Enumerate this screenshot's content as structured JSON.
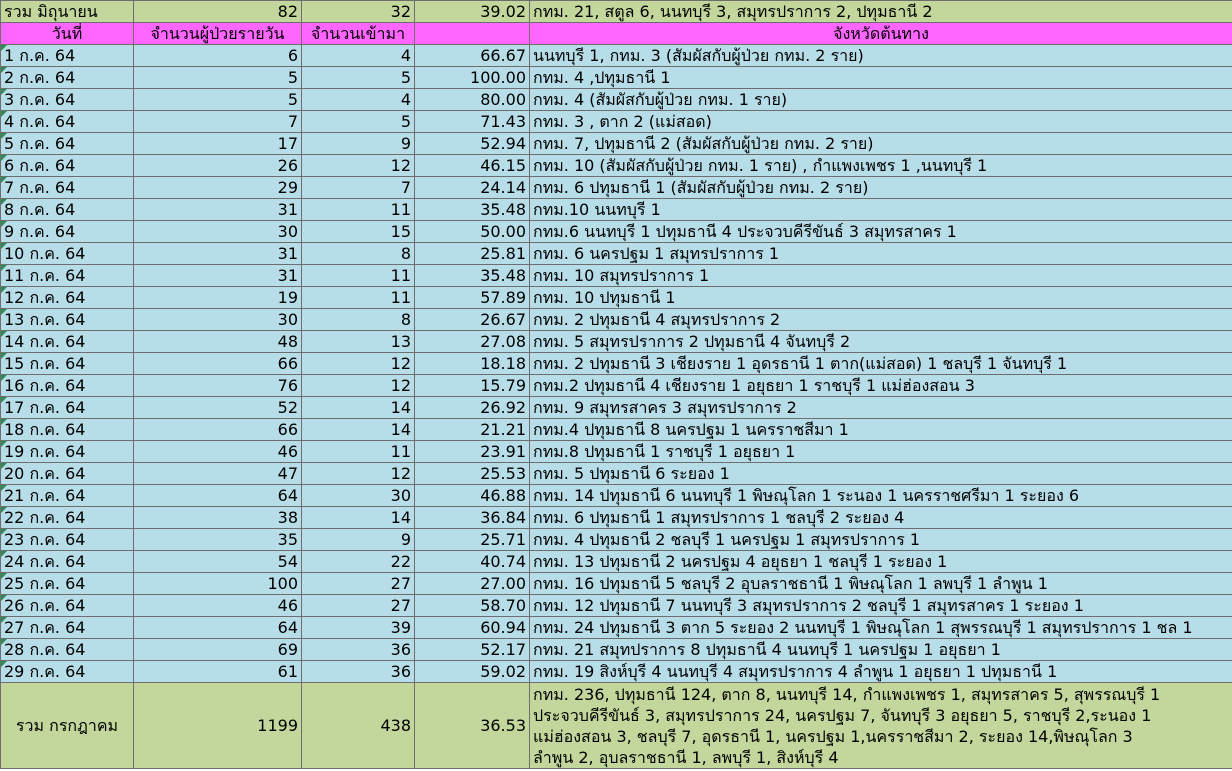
{
  "june_total": {
    "label": "รวม มิถุนายน",
    "daily": "82",
    "inbound": "32",
    "percent": "39.02",
    "provinces": "กทม. 21, สตูล 6, นนทบุรี 3, สมุทรปราการ 2, ปทุมธานี 2"
  },
  "headers": {
    "date": "วันที่",
    "daily": "จำนวนผู้ป่วยรายวัน",
    "inbound": "จำนวนเข้ามา",
    "percent": "",
    "provinces": "จังหวัดต้นทาง"
  },
  "rows": [
    {
      "date": "1 ก.ค. 64",
      "daily": "6",
      "inbound": "4",
      "percent": "66.67",
      "provinces": "นนทบุรี 1, กทม. 3          (สัมผัสกับผู้ป่วย กทม. 2 ราย)"
    },
    {
      "date": "2 ก.ค. 64",
      "daily": "5",
      "inbound": "5",
      "percent": "100.00",
      "provinces": "กทม. 4 ,ปทุมธานี 1"
    },
    {
      "date": "3 ก.ค. 64",
      "daily": "5",
      "inbound": "4",
      "percent": "80.00",
      "provinces": "กทม. 4                              (สัมผัสกับผู้ป่วย กทม. 1 ราย)"
    },
    {
      "date": "4 ก.ค. 64",
      "daily": "7",
      "inbound": "5",
      "percent": "71.43",
      "provinces": "กทม. 3 , ตาก 2 (แม่สอด)"
    },
    {
      "date": "5 ก.ค. 64",
      "daily": "17",
      "inbound": "9",
      "percent": "52.94",
      "provinces": "กทม. 7, ปทุมธานี 2      (สัมผัสกับผู้ป่วย กทม. 2 ราย)"
    },
    {
      "date": "6 ก.ค. 64",
      "daily": "26",
      "inbound": "12",
      "percent": "46.15",
      "provinces": "กทม. 10 (สัมผัสกับผู้ป่วย กทม. 1 ราย) , กำแพงเพชร 1 ,นนทบุรี 1"
    },
    {
      "date": "7 ก.ค. 64",
      "daily": "29",
      "inbound": "7",
      "percent": "24.14",
      "provinces": "กทม. 6 ปทุมธานี 1 (สัมผัสกับผู้ป่วย กทม. 2 ราย)"
    },
    {
      "date": "8 ก.ค. 64",
      "daily": "31",
      "inbound": "11",
      "percent": "35.48",
      "provinces": "กทม.10 นนทบุรี 1"
    },
    {
      "date": "9 ก.ค. 64",
      "daily": "30",
      "inbound": "15",
      "percent": "50.00",
      "provinces": "กทม.6 นนทบุรี 1 ปทุมธานี 4 ประจวบคีรีขันธ์ 3 สมุทรสาคร 1"
    },
    {
      "date": "10 ก.ค. 64",
      "daily": "31",
      "inbound": "8",
      "percent": "25.81",
      "provinces": "กทม. 6 นครปฐม 1 สมุทรปราการ 1"
    },
    {
      "date": "11 ก.ค. 64",
      "daily": "31",
      "inbound": "11",
      "percent": "35.48",
      "provinces": "กทม. 10 สมุทรปราการ 1"
    },
    {
      "date": "12 ก.ค. 64",
      "daily": "19",
      "inbound": "11",
      "percent": "57.89",
      "provinces": "กทม. 10 ปทุมธานี 1"
    },
    {
      "date": "13 ก.ค. 64",
      "daily": "30",
      "inbound": "8",
      "percent": "26.67",
      "provinces": "กทม. 2 ปทุมธานี 4 สมุทรปราการ 2"
    },
    {
      "date": "14 ก.ค. 64",
      "daily": "48",
      "inbound": "13",
      "percent": "27.08",
      "provinces": "กทม. 5 สมุทรปราการ 2 ปทุมธานี 4 จันทบุรี 2"
    },
    {
      "date": "15 ก.ค. 64",
      "daily": "66",
      "inbound": "12",
      "percent": "18.18",
      "provinces": "กทม. 2 ปทุมธานี 3 เชียงราย 1 อุดรธานี 1 ตาก(แม่สอด) 1 ชลบุรี 1 จันทบุรี 1"
    },
    {
      "date": "16 ก.ค. 64",
      "daily": "76",
      "inbound": "12",
      "percent": "15.79",
      "provinces": "กทม.2 ปทุมธานี 4 เชียงราย 1 อยุธยา 1 ราชบุรี 1 แม่ฮ่องสอน 3"
    },
    {
      "date": "17 ก.ค. 64",
      "daily": "52",
      "inbound": "14",
      "percent": "26.92",
      "provinces": "กทม. 9 สมุทรสาคร 3 สมุทรปราการ 2"
    },
    {
      "date": "18 ก.ค. 64",
      "daily": "66",
      "inbound": "14",
      "percent": "21.21",
      "provinces": "กทม.4 ปทุมธานี 8 นครปฐม 1 นครราชสีมา 1"
    },
    {
      "date": "19 ก.ค. 64",
      "daily": "46",
      "inbound": "11",
      "percent": "23.91",
      "provinces": "กทม.8 ปทุมธานี 1 ราชบุรี 1 อยุธยา 1"
    },
    {
      "date": "20 ก.ค. 64",
      "daily": "47",
      "inbound": "12",
      "percent": "25.53",
      "provinces": "กทม. 5 ปทุมธานี 6 ระยอง 1"
    },
    {
      "date": "21 ก.ค. 64",
      "daily": "64",
      "inbound": "30",
      "percent": "46.88",
      "provinces": "กทม. 14 ปทุมธานี 6 นนทบุรี 1 พิษณุโลก 1 ระนอง 1 นครราชศรีมา 1 ระยอง 6"
    },
    {
      "date": "22 ก.ค. 64",
      "daily": "38",
      "inbound": "14",
      "percent": "36.84",
      "provinces": "กทม. 6 ปทุมธานี 1 สมุทรปราการ 1 ชลบุรี 2 ระยอง 4"
    },
    {
      "date": "23 ก.ค. 64",
      "daily": "35",
      "inbound": "9",
      "percent": "25.71",
      "provinces": "กทม. 4 ปทุมธานี 2 ชลบุรี 1 นครปฐม 1 สมุทรปราการ 1"
    },
    {
      "date": "24 ก.ค. 64",
      "daily": "54",
      "inbound": "22",
      "percent": "40.74",
      "provinces": "กทม. 13 ปทุมธานี 2 นครปฐม 4 อยุธยา 1 ชลบุรี 1 ระยอง 1"
    },
    {
      "date": "25 ก.ค. 64",
      "daily": "100",
      "inbound": "27",
      "percent": "27.00",
      "provinces": "กทม. 16 ปทุมธานี 5 ชลบุรี 2 อุบลราชธานี 1 พิษณุโลก 1 ลพบุรี 1 ลำพูน 1"
    },
    {
      "date": "26 ก.ค. 64",
      "daily": "46",
      "inbound": "27",
      "percent": "58.70",
      "provinces": "กทม. 12 ปทุมธานี 7 นนทบุรี 3 สมุทรปราการ 2 ชลบุรี 1 สมุทรสาคร 1 ระยอง 1"
    },
    {
      "date": "27 ก.ค. 64",
      "daily": "64",
      "inbound": "39",
      "percent": "60.94",
      "provinces": "กทม. 24 ปทุมธานี 3 ตาก 5 ระยอง 2 นนทบุรี 1 พิษณุโลก 1 สุพรรณบุรี 1 สมุทรปราการ 1 ชล 1"
    },
    {
      "date": "28 ก.ค. 64",
      "daily": "69",
      "inbound": "36",
      "percent": "52.17",
      "provinces": "กทม. 21 สมุทปราการ 8 ปทุมธานี 4 นนทบุรี 1 นครปฐม 1 อยุธยา 1"
    },
    {
      "date": "29 ก.ค. 64",
      "daily": "61",
      "inbound": "36",
      "percent": "59.02",
      "provinces": "กทม. 19 สิงห์บุรี 4 นนทบุรี 4 สมุทรปราการ 4 ลำพูน 1 อยุธยา 1 ปทุมธานี 1"
    }
  ],
  "july_total": {
    "label": "รวม กรกฎาคม",
    "daily": "1199",
    "inbound": "438",
    "percent": "36.53",
    "provinces_lines": [
      "กทม. 236, ปทุมธานี 124, ตาก 8, นนทบุรี 14, กำแพงเพชร 1, สมุทรสาคร 5, สุพรรณบุรี 1",
      "ประจวบคีรีขันธ์ 3, สมุทรปราการ 24, นครปฐม 7, จันทบุรี 3 อยุธยา 5, ราชบุรี 2,ระนอง 1",
      "แม่ฮ่องสอน 3, ชลบุรี 7, อุดรธานี 1, นครปฐม 1,นครราชสีมา 2, ระยอง 14,พิษณุโลก 3",
      "ลำพูน 2, อุบลราชธานี 1, ลพบุรี 1, สิงห์บุรี 4"
    ]
  },
  "colors": {
    "header": "#ff66ff",
    "row": "#b7dde8",
    "total": "#c3d69b"
  }
}
